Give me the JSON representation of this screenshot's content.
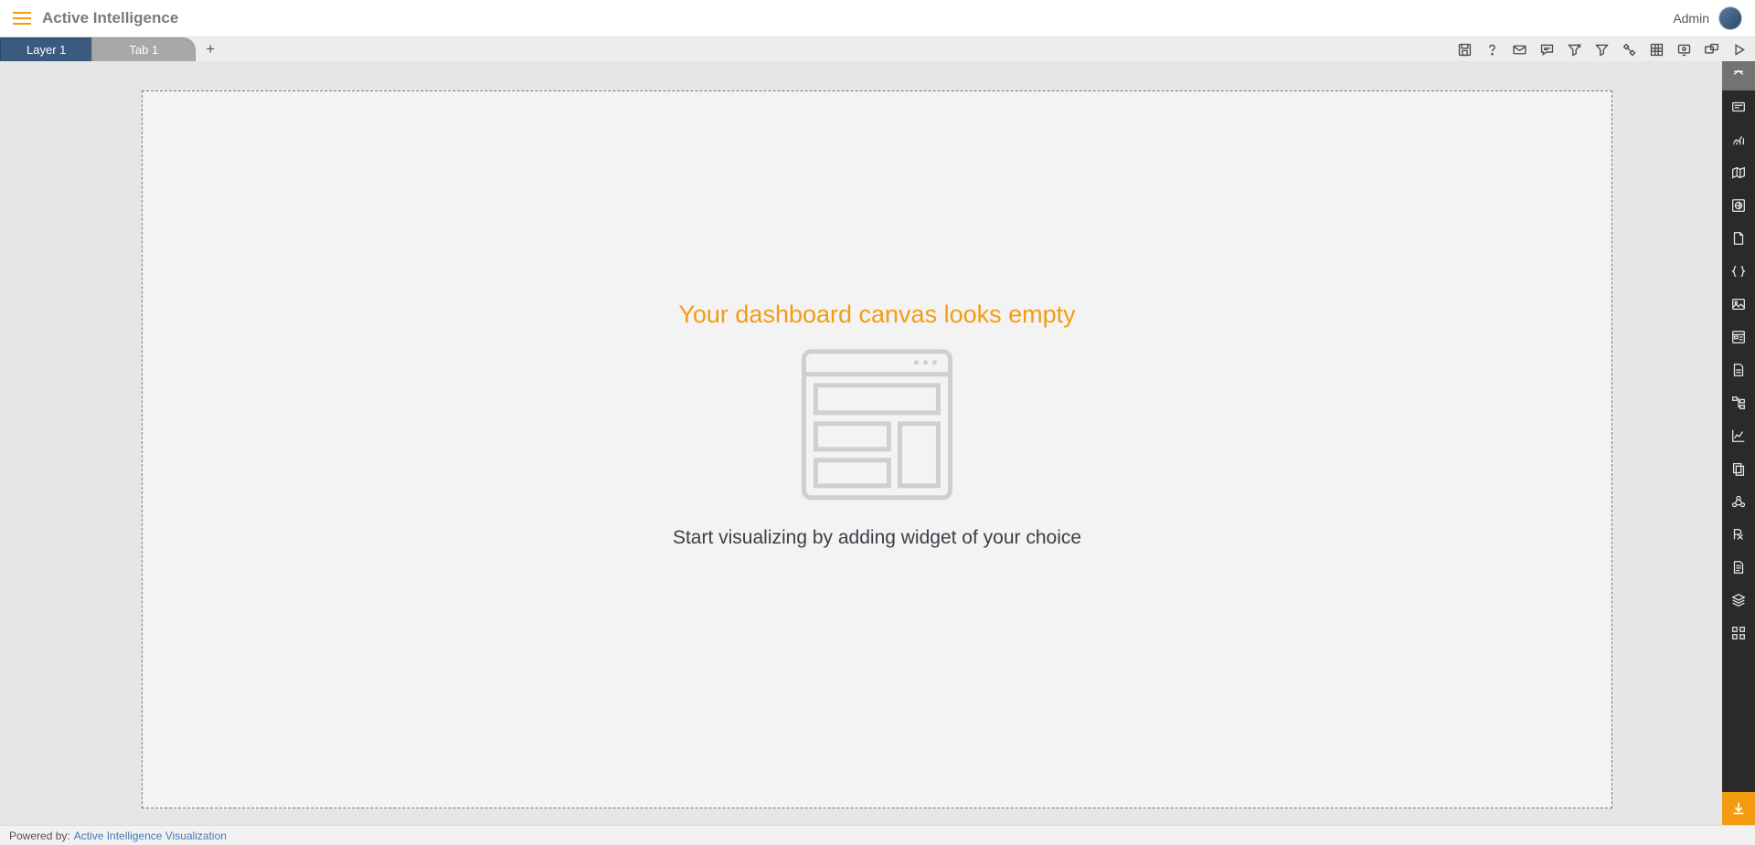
{
  "header": {
    "app_title": "Active Intelligence",
    "user_name": "Admin"
  },
  "tabs": {
    "active": "Layer 1",
    "inactive": "Tab 1"
  },
  "toolbar_icons": [
    "save-icon",
    "help-icon",
    "mail-icon",
    "comment-icon",
    "clear-filter-icon",
    "filter-icon",
    "tools-icon",
    "grid-icon",
    "presentation-icon",
    "screens-icon",
    "play-icon"
  ],
  "canvas": {
    "empty_title": "Your dashboard canvas looks empty",
    "empty_sub": "Start visualizing by adding widget of your choice"
  },
  "palette_icons": [
    "card-icon",
    "chart-icon",
    "map-icon",
    "globe-widget-icon",
    "page-icon",
    "braces-icon",
    "image-icon",
    "form-icon",
    "file-icon",
    "tree-icon",
    "trend-icon",
    "copy-icon",
    "cluster-icon",
    "rx-icon",
    "doc-icon",
    "layers-icon",
    "components-icon"
  ],
  "footer": {
    "prefix": "Powered by:",
    "link": "Active Intelligence Visualization"
  }
}
